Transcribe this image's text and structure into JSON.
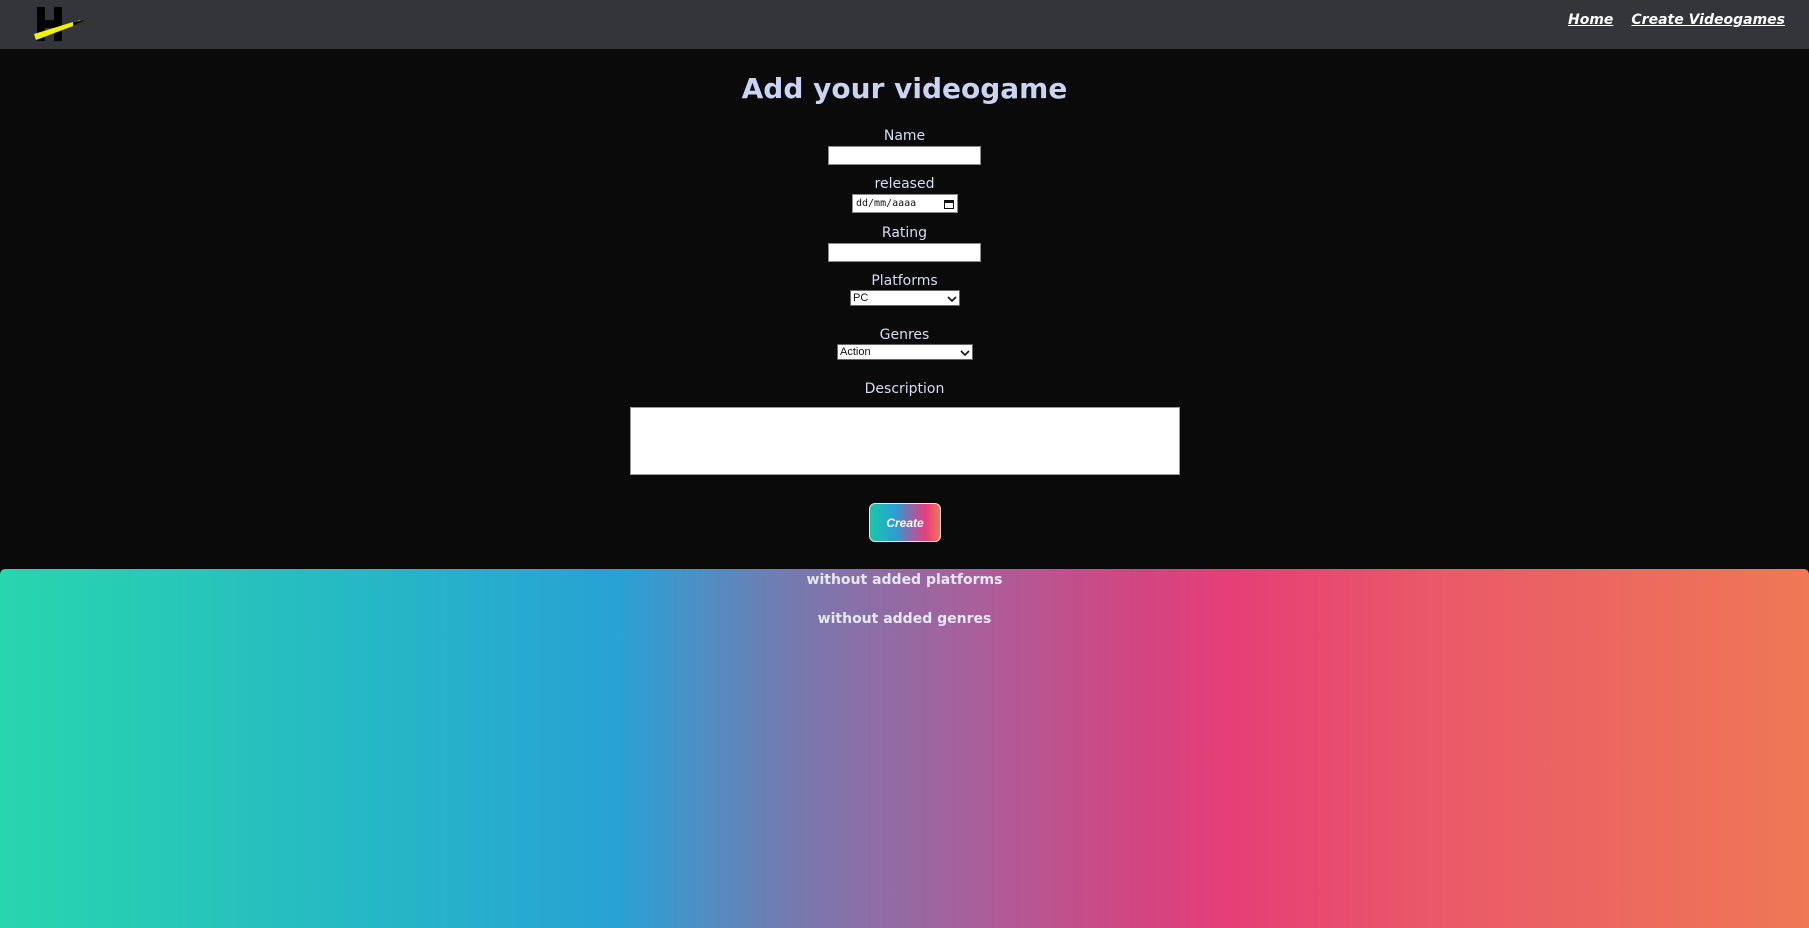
{
  "nav": {
    "logo_icon": "hero-logo-icon",
    "links": [
      "Home",
      "Create Videogames"
    ]
  },
  "form": {
    "title": "Add your videogame",
    "name_label": "Name",
    "name_value": "",
    "released_label": "released",
    "released_placeholder": "dd/mm/aaaa",
    "rating_label": "Rating",
    "rating_value": "",
    "platforms_label": "Platforms",
    "platforms_selected": "PC",
    "genres_label": "Genres",
    "genres_selected": "Action",
    "description_label": "Description",
    "description_value": "",
    "create_label": "Create"
  },
  "preview": {
    "platforms_text": "without added platforms",
    "genres_text": "without added genres"
  },
  "colors": {
    "navbar_bg": "#34353a",
    "page_bg": "#0a0a0a",
    "label_color": "#c9d3f2",
    "gradient_start": "#28d6ad",
    "gradient_mid_blue": "#28a2d5",
    "gradient_pink": "#e63e77",
    "gradient_end": "#ef7856"
  }
}
